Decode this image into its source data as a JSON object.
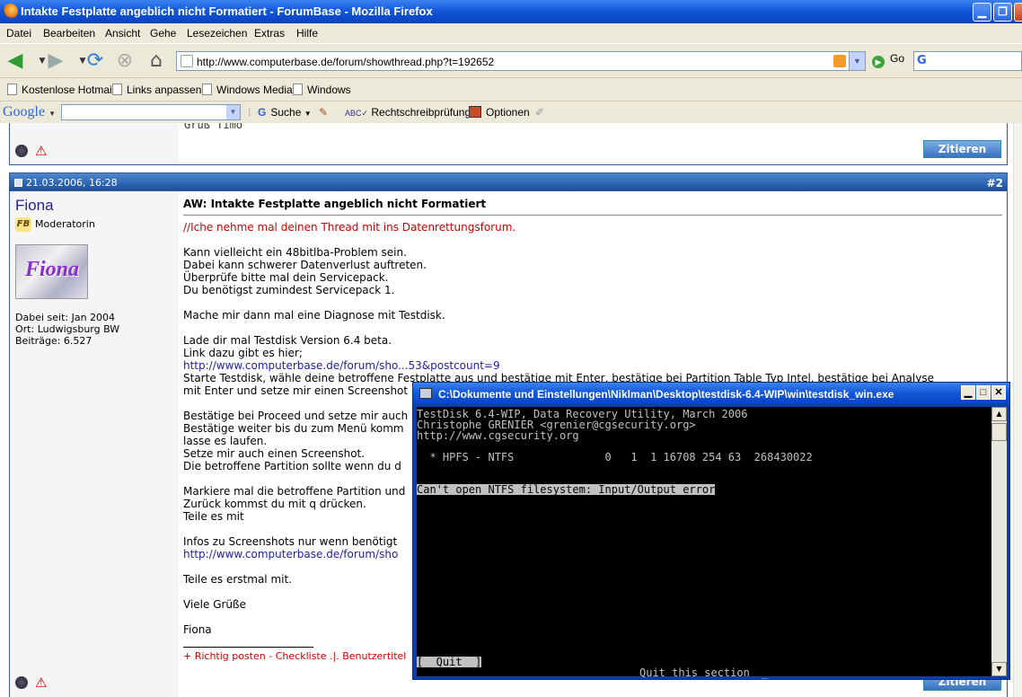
{
  "window": {
    "title": "Intakte Festplatte angeblich nicht Formatiert - ForumBase - Mozilla Firefox"
  },
  "menu": [
    "Datei",
    "Bearbeiten",
    "Ansicht",
    "Gehe",
    "Lesezeichen",
    "Extras",
    "Hilfe"
  ],
  "nav": {
    "url": "http://www.computerbase.de/forum/showthread.php?t=192652",
    "go_label": "Go"
  },
  "bookmarks": [
    "Kostenlose Hotmail",
    "Links anpassen",
    "Windows Media",
    "Windows"
  ],
  "googlebar": {
    "logo": "Google",
    "search_label": "Suche",
    "spell_label": "Rechtschreibprüfung",
    "options_label": "Optionen"
  },
  "prev_post": {
    "greeting": "Gruß Timo",
    "quote_label": "Zitieren"
  },
  "post": {
    "date": "21.03.2006, 16:28",
    "number": "#2",
    "user": {
      "name": "Fiona",
      "title": "Moderatorin",
      "avatar_text": "Fiona",
      "joined": "Dabei seit: Jan 2004",
      "location": "Ort: Ludwigsburg BW",
      "posts": "Beiträge: 6.527"
    },
    "subject": "AW: Intakte Festplatte angeblich nicht Formatiert",
    "lines": [
      "//Iche nehme mal deinen Thread mit ins Datenrettungsforum.",
      "Kann vielleicht ein 48bitlba-Problem sein.",
      "Dabei kann schwerer Datenverlust auftreten.",
      "Überprüfe bitte mal dein Servicepack.",
      "Du benötigst zumindest Servicepack 1.",
      "Mache mir dann mal eine Diagnose mit Testdisk.",
      "Lade dir mal Testdisk Version 6.4 beta.",
      "Link dazu gibt es hier;",
      "http://www.computerbase.de/forum/sho...53&postcount=9",
      "Starte Testdisk, wähle deine betroffene Festplatte aus und bestätige mit Enter, bestätige bei Partition Table Typ Intel, bestätige bei Analyse",
      "mit Enter und setze mir einen Screenshot",
      "Bestätige bei Proceed und setze mir auch",
      "Bestätige weiter bis du zum Menü komm",
      "lasse es laufen.",
      "Setze mir auch einen Screenshot.",
      "Die betroffene Partition sollte wenn du d",
      "Markiere mal die betroffene Partition und",
      "Zurück kommst du mit q drücken.",
      "Teile es mit",
      "Infos zu Screenshots nur wenn benötigt",
      "http://www.computerbase.de/forum/sho",
      "Teile es erstmal mit.",
      "Viele Grüße",
      "Fiona"
    ],
    "signature": "+ Richtig posten - Checkliste .|. Benutzertitel",
    "quote_label": "Zitieren"
  },
  "console": {
    "title": "C:\\Dokumente und Einstellungen\\Niklman\\Desktop\\testdisk-6.4-WIP\\win\\testdisk_win.exe",
    "lines": [
      "TestDisk 6.4-WIP, Data Recovery Utility, March 2006",
      "Christophe GRENIER <grenier@cgsecurity.org>",
      "http://www.cgsecurity.org",
      "  * HPFS - NTFS              0   1  1 16708 254 63  268430022",
      "Can't open NTFS filesystem: Input/Output error",
      "[  Quit  ]",
      "Quit this section"
    ]
  }
}
